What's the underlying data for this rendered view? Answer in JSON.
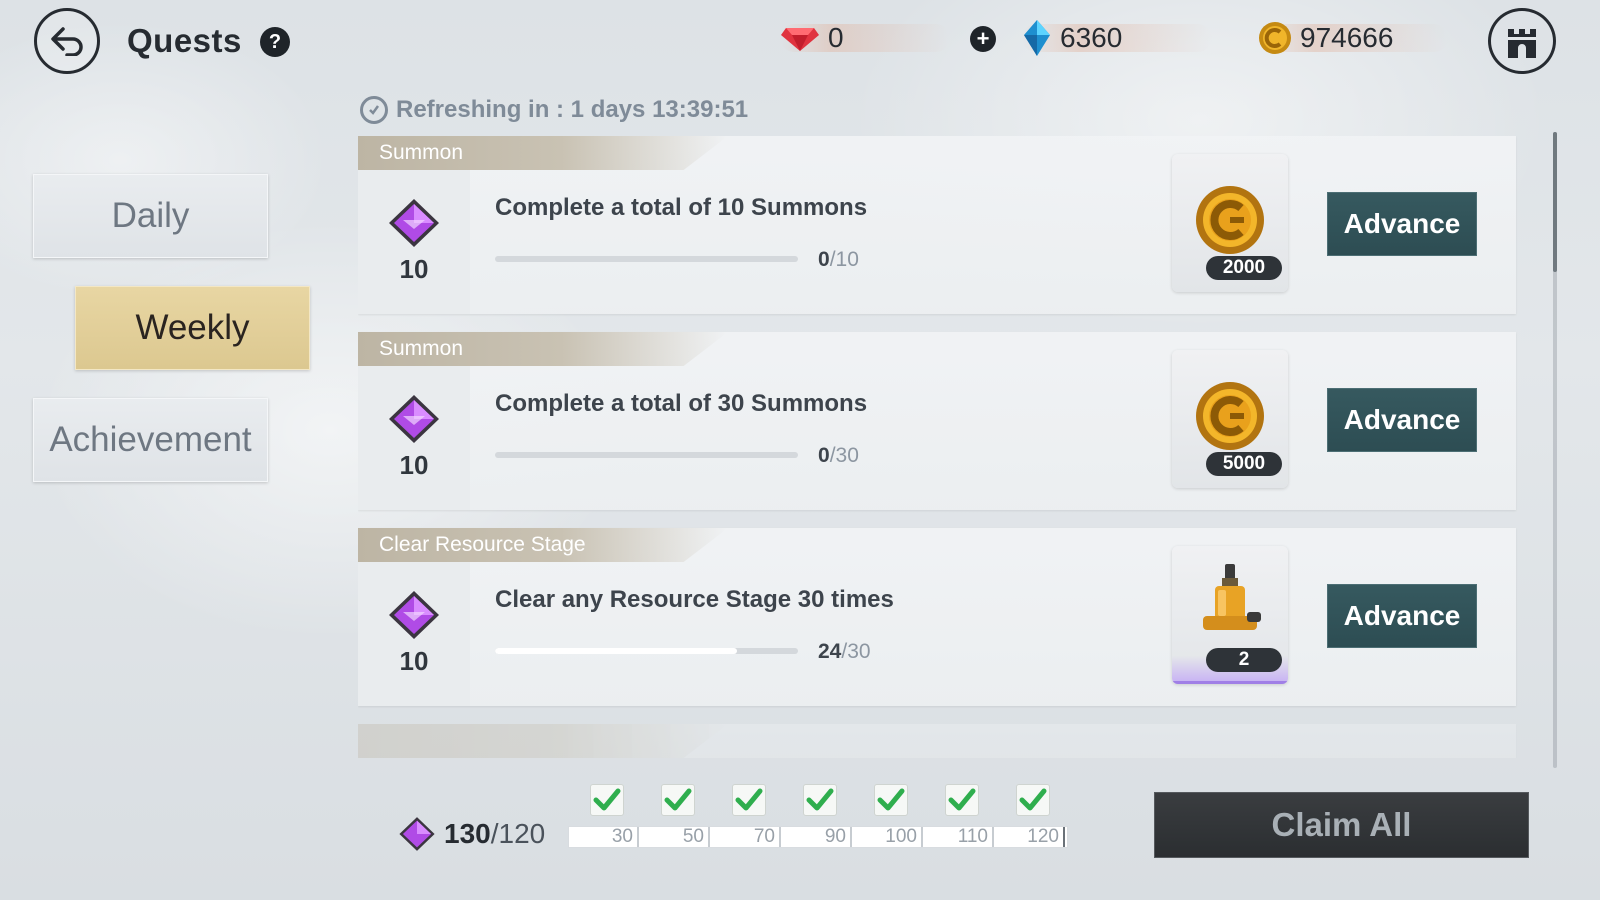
{
  "header": {
    "title": "Quests",
    "help_icon": "?",
    "currencies": {
      "ruby": {
        "icon": "ruby-icon",
        "value": "0"
      },
      "gem": {
        "icon": "blue-crystal-icon",
        "value": "6360"
      },
      "gold": {
        "icon": "gold-coin-icon",
        "value": "974666"
      }
    },
    "add_icon": "+"
  },
  "tabs": [
    {
      "label": "Daily",
      "selected": false
    },
    {
      "label": "Weekly",
      "selected": true
    },
    {
      "label": "Achievement",
      "selected": false
    }
  ],
  "refresh": {
    "text": "Refreshing in : 1 days 13:39:51"
  },
  "quests": [
    {
      "category": "Summon",
      "points": "10",
      "title": "Complete a total of 10 Summons",
      "progress_current": "0",
      "progress_total": "/10",
      "progress_fraction": 0,
      "reward_icon": "gold-coin-icon",
      "reward_qty": "2000",
      "button": "Advance"
    },
    {
      "category": "Summon",
      "points": "10",
      "title": "Complete a total of 30 Summons",
      "progress_current": "0",
      "progress_total": "/30",
      "progress_fraction": 0,
      "reward_icon": "gold-coin-icon",
      "reward_qty": "5000",
      "button": "Advance"
    },
    {
      "category": "Clear Resource Stage",
      "points": "10",
      "title": "Clear any Resource Stage 30 times",
      "progress_current": "24",
      "progress_total": "/30",
      "progress_fraction": 0.8,
      "reward_icon": "potion-bottle-icon",
      "reward_qty": "2",
      "button": "Advance"
    }
  ],
  "footer": {
    "points_current": "130",
    "points_total": "/120",
    "milestones": [
      "30",
      "50",
      "70",
      "90",
      "100",
      "110",
      "120"
    ],
    "claim_all": "Claim All"
  },
  "colors": {
    "accent_button": "#2d4d53",
    "weekly_tab": "#dcc890",
    "points_gem": "#9b3fd1"
  }
}
